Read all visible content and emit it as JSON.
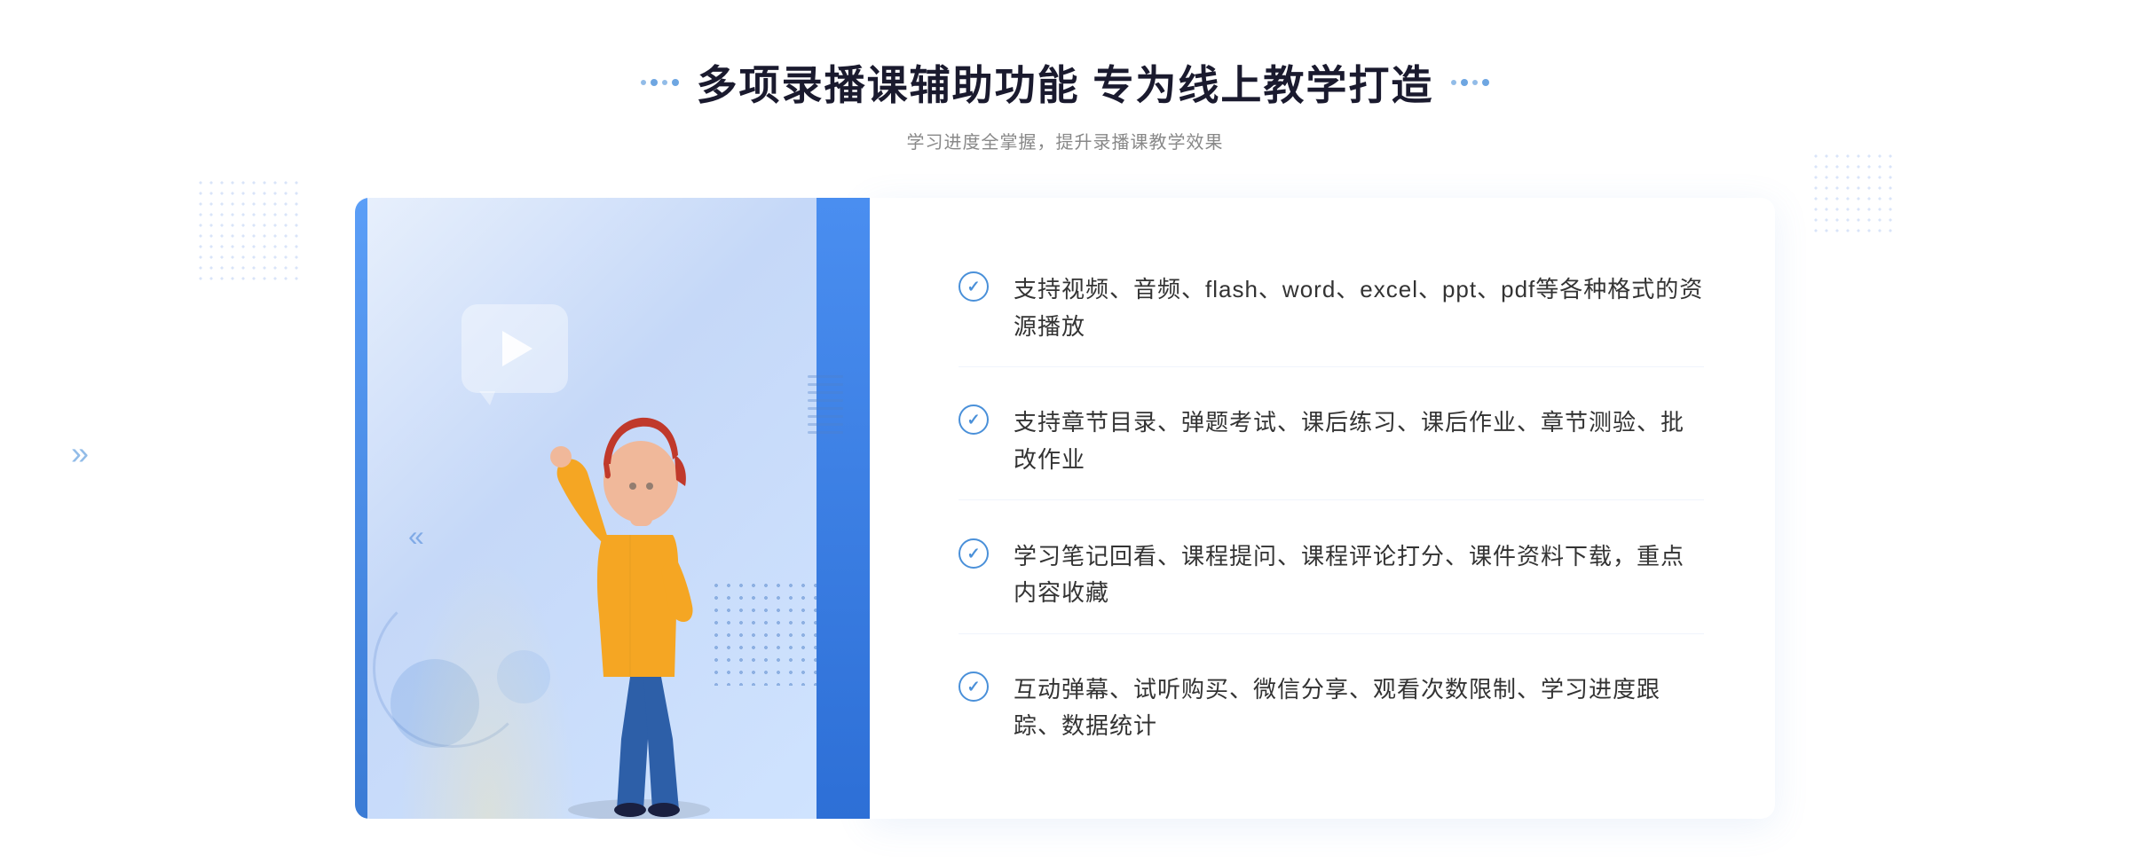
{
  "page": {
    "background_color": "#ffffff"
  },
  "header": {
    "title": "多项录播课辅助功能 专为线上教学打造",
    "subtitle": "学习进度全掌握，提升录播课教学效果",
    "title_left_dots": "decorative",
    "title_right_dots": "decorative"
  },
  "features": [
    {
      "id": 1,
      "text": "支持视频、音频、flash、word、excel、ppt、pdf等各种格式的资源播放"
    },
    {
      "id": 2,
      "text": "支持章节目录、弹题考试、课后练习、课后作业、章节测验、批改作业"
    },
    {
      "id": 3,
      "text": "学习笔记回看、课程提问、课程评论打分、课件资料下载，重点内容收藏"
    },
    {
      "id": 4,
      "text": "互动弹幕、试听购买、微信分享、观看次数限制、学习进度跟踪、数据统计"
    }
  ],
  "decorations": {
    "arrow_left": "»",
    "chevron_arrows": "«",
    "play_icon": "▶"
  },
  "colors": {
    "blue_primary": "#4a90d9",
    "blue_dark": "#3a7bd5",
    "blue_light": "#e8f0fc",
    "text_dark": "#1a1a2e",
    "text_gray": "#888888",
    "text_body": "#333333"
  }
}
